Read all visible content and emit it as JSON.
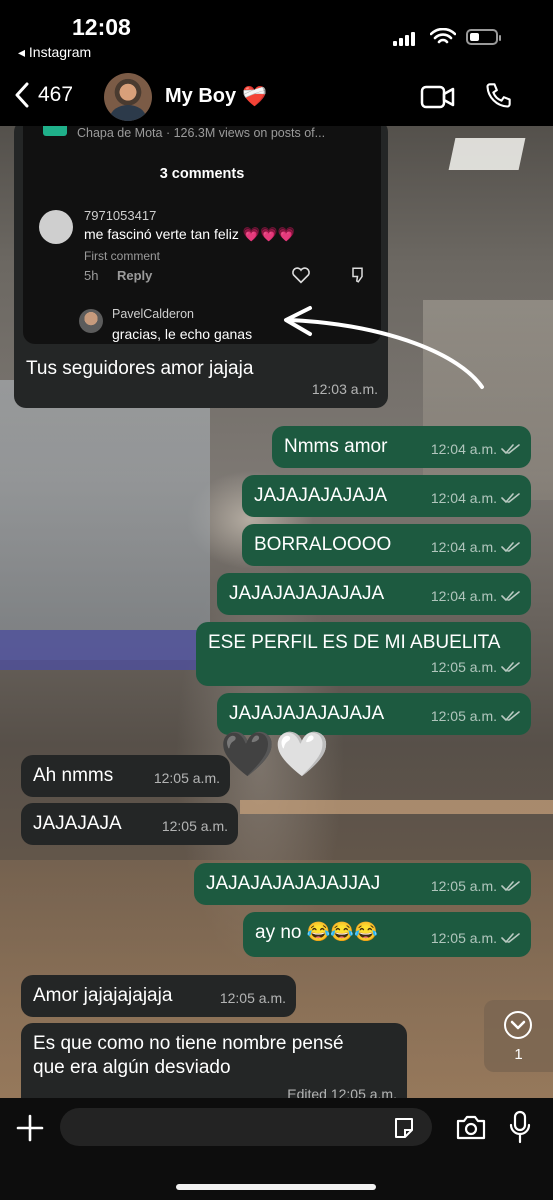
{
  "status_bar": {
    "time": "12:08",
    "back_app": "◂ Instagram"
  },
  "header": {
    "back_count": "467",
    "contact_name": "My Boy",
    "contact_emoji": "❤️‍🩹"
  },
  "card": {
    "source_text": "Chapa de Mota · 126.3M views on posts of...",
    "comments_title": "3 comments",
    "comment": {
      "username": "7971053417",
      "text": "me fascinó verte tan feliz 💗💗💗",
      "tag": "First comment",
      "age": "5h",
      "reply_label": "Reply"
    },
    "reply": {
      "username": "PavelCalderon",
      "text": "gracias, le echo ganas"
    }
  },
  "messages": [
    {
      "text": "Tus seguidores amor jajaja",
      "time": "12:03 a.m.",
      "dir": "in"
    },
    {
      "text": "Nmms amor",
      "time": "12:04 a.m.",
      "dir": "out"
    },
    {
      "text": "JAJAJAJAJAJA",
      "time": "12:04 a.m.",
      "dir": "out"
    },
    {
      "text": "BORRALOOOO",
      "time": "12:04 a.m.",
      "dir": "out"
    },
    {
      "text": "JAJAJAJAJAJAJA",
      "time": "12:04 a.m.",
      "dir": "out"
    },
    {
      "text": "ESE PERFIL ES DE MI ABUELITA",
      "time": "12:05 a.m.",
      "dir": "out"
    },
    {
      "text": "JAJAJAJAJAJAJA",
      "time": "12:05 a.m.",
      "dir": "out"
    },
    {
      "text": "🖤🤍",
      "dir": "out"
    },
    {
      "text": "Ah nmms",
      "time": "12:05 a.m.",
      "dir": "in"
    },
    {
      "text": "JAJAJAJA",
      "time": "12:05 a.m.",
      "dir": "in"
    },
    {
      "text": "JAJAJAJAJAJAJJAJ",
      "time": "12:05 a.m.",
      "dir": "out"
    },
    {
      "text": "ay no 😂😂😂",
      "time": "12:05 a.m.",
      "dir": "out"
    },
    {
      "text": "Amor jajajajajaja",
      "time": "12:05 a.m.",
      "dir": "in"
    },
    {
      "text": "Es que como no tiene nombre pensé\nque era algún desviado",
      "time": "Edited 12:05 a.m.",
      "dir": "in"
    }
  ],
  "scroll_button": {
    "unread_count": "1"
  },
  "colors": {
    "outgoing_bubble": "#1d5a40",
    "incoming_bubble": "#242626",
    "read_ticks": "#b9c9c1"
  }
}
